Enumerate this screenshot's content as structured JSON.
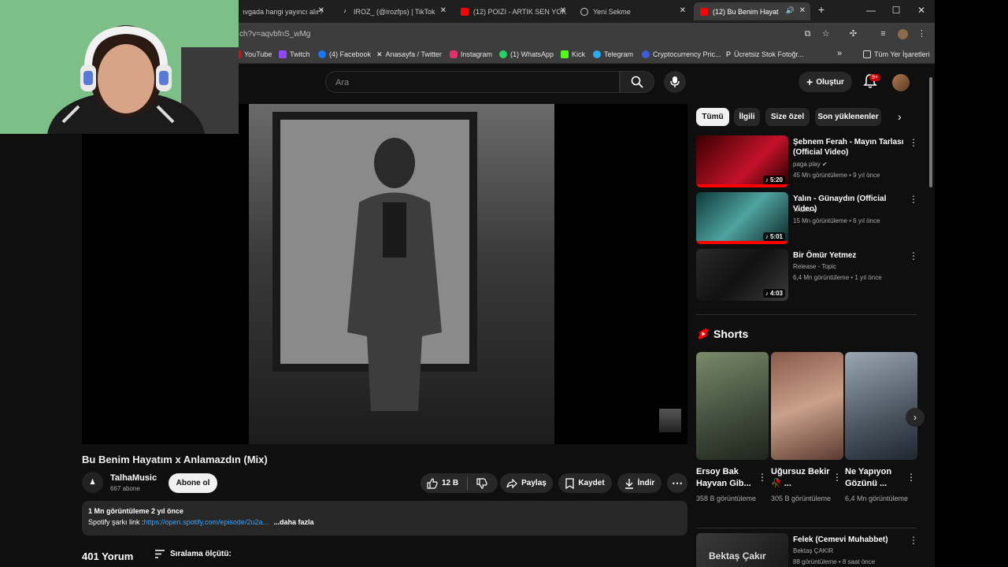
{
  "tabs": [
    {
      "title": "ıvgada hangi yayıncı alır?",
      "active": false
    },
    {
      "title": "IROZ_ (@irozfps) | TikTok",
      "active": false
    },
    {
      "title": "(12) POIZI - ARTIK SEN YOK",
      "active": false
    },
    {
      "title": "Yeni Sekme",
      "active": false
    },
    {
      "title": "(12) Bu Benim Hayatım",
      "active": true
    }
  ],
  "address": {
    "url": "ch?v=aqvbfnS_wMg"
  },
  "bookmarks": [
    {
      "label": "YouTube",
      "color": "#ff0000"
    },
    {
      "label": "Twitch",
      "color": "#9146ff"
    },
    {
      "label": "(4) Facebook",
      "color": "#1877f2"
    },
    {
      "label": "Anasayfa / Twitter",
      "color": "#ffffff"
    },
    {
      "label": "Instagram",
      "color": "#e1306c"
    },
    {
      "label": "(1) WhatsApp",
      "color": "#25d366"
    },
    {
      "label": "Kick",
      "color": "#53fc18"
    },
    {
      "label": "Telegram",
      "color": "#2aabee"
    },
    {
      "label": "Cryptocurrency Pric...",
      "color": "#8dc63f"
    },
    {
      "label": "Ücretsiz Stok Fotoğr...",
      "color": "#ffffff"
    }
  ],
  "bookmarks_more": "»",
  "all_bookmarks": "Tüm Yer İşaretleri",
  "search": {
    "placeholder": "Ara"
  },
  "create": {
    "label": "Oluştur"
  },
  "notifications": {
    "badge": "9+"
  },
  "video": {
    "title": "Bu Benim Hayatım x Anlamazdın (Mix)",
    "channel": "TalhaMusic",
    "subscribers": "667 abone",
    "subscribe": "Abone ol",
    "likes": "12 B",
    "share": "Paylaş",
    "save": "Kaydet",
    "download": "İndir",
    "views_date": "1 Mn görüntüleme  2 yıl önce",
    "desc_prefix": "Spotify şarkı link :",
    "desc_link": "https://open.spotify.com/episode/2u2a...",
    "desc_more": "...daha fazla",
    "comments": "401 Yorum",
    "sort": "Sıralama ölçütü:"
  },
  "chips": [
    {
      "label": "Tümü",
      "selected": true
    },
    {
      "label": "İlgili",
      "selected": false
    },
    {
      "label": "Size özel",
      "selected": false
    },
    {
      "label": "Son yüklenenler",
      "selected": false
    }
  ],
  "recommendations": [
    {
      "title": "Şebnem Ferah - Mayın Tarlası (Official Video)",
      "channel": "paga play",
      "meta": "45 Mn görüntüleme • 9 yıl önce",
      "duration": "5:20",
      "verified": true
    },
    {
      "title": "Yalın - Günaydın (Official Video)",
      "channel": "YALIN",
      "meta": "15 Mn görüntüleme • 6 yıl önce",
      "duration": "5:01",
      "verified": true
    },
    {
      "title": "Bir Ömür Yetmez",
      "channel": "Release - Topic",
      "meta": "6,4 Mn görüntüleme • 1 yıl önce",
      "duration": "4:03",
      "verified": false
    },
    {
      "title": "Felek (Cemevi Muhabbet)",
      "channel": "Bektaş ÇAKIR",
      "meta": "88 görüntüleme • 8 saat önce",
      "duration": "",
      "verified": false
    }
  ],
  "rec_last_thumb_text": "Bektaş Çakır",
  "shorts": {
    "heading": "Shorts",
    "items": [
      {
        "title": "Ersoy Bak Hayvan Gib...",
        "views": "358 B görüntüleme"
      },
      {
        "title": "Uğursuz Bekir 🥀 ...",
        "views": "305 B görüntüleme"
      },
      {
        "title": "Ne Yapıyon Gözünü ...",
        "views": "6,4 Mn görüntüleme"
      }
    ]
  },
  "colors": {
    "accent": "#ff0000",
    "link": "#3ea6ff",
    "bg": "#0f0f0f"
  }
}
